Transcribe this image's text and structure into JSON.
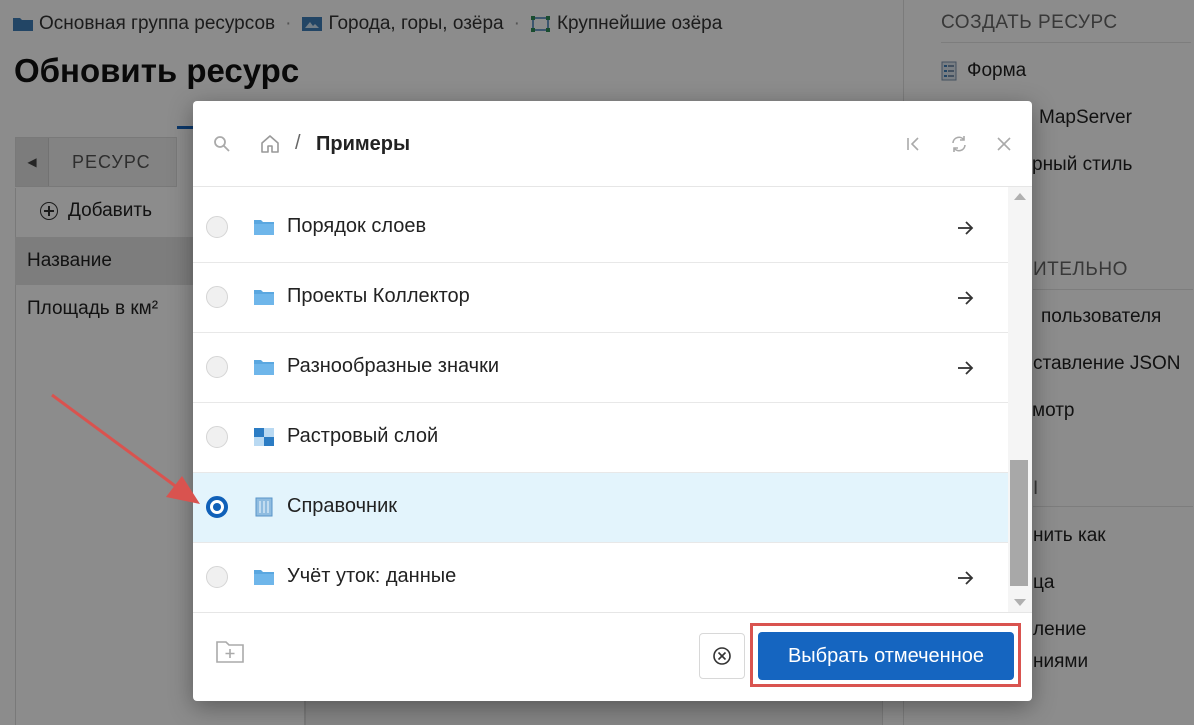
{
  "breadcrumb": [
    {
      "label": "Основная группа ресурсов",
      "icon": "folder-icon"
    },
    {
      "label": "Города, горы, озёра",
      "icon": "map-icon"
    },
    {
      "label": "Крупнейшие озёра",
      "icon": "vector-layer-icon"
    }
  ],
  "page_title": "Обновить ресурс",
  "tabs": {
    "resource_label": "РЕСУРС"
  },
  "add_label": "Добавить",
  "fields": [
    "Название",
    "Площадь в км²"
  ],
  "sidebar": {
    "create_heading": "СОЗДАТЬ РЕСУРС",
    "create_items": [
      "Форма",
      "MapServer",
      "рный стиль"
    ],
    "extra_heading": "ИТЕЛЬНО",
    "extra_items": [
      "пользователя",
      "ставление JSON",
      "мотр"
    ],
    "more_heading": "I",
    "more_items": [
      "нить как",
      "ца",
      "ление",
      "ниями"
    ]
  },
  "modal": {
    "breadcrumb_current": "Примеры",
    "rows": [
      {
        "label": "Порядок слоев",
        "icon": "folder-icon",
        "has_arrow": true,
        "checked": false
      },
      {
        "label": "Проекты Коллектор",
        "icon": "folder-icon",
        "has_arrow": true,
        "checked": false
      },
      {
        "label": "Разнообразные значки",
        "icon": "folder-icon",
        "has_arrow": true,
        "checked": false
      },
      {
        "label": "Растровый слой",
        "icon": "raster-layer-icon",
        "has_arrow": false,
        "checked": false
      },
      {
        "label": "Справочник",
        "icon": "lookup-table-icon",
        "has_arrow": false,
        "checked": true
      },
      {
        "label": "Учёт уток: данные",
        "icon": "folder-icon",
        "has_arrow": true,
        "checked": false
      }
    ],
    "select_button": "Выбрать отмеченное"
  },
  "colors": {
    "accent": "#1565c0",
    "annotation": "#d9534f",
    "folder": "#5aa7e0"
  }
}
